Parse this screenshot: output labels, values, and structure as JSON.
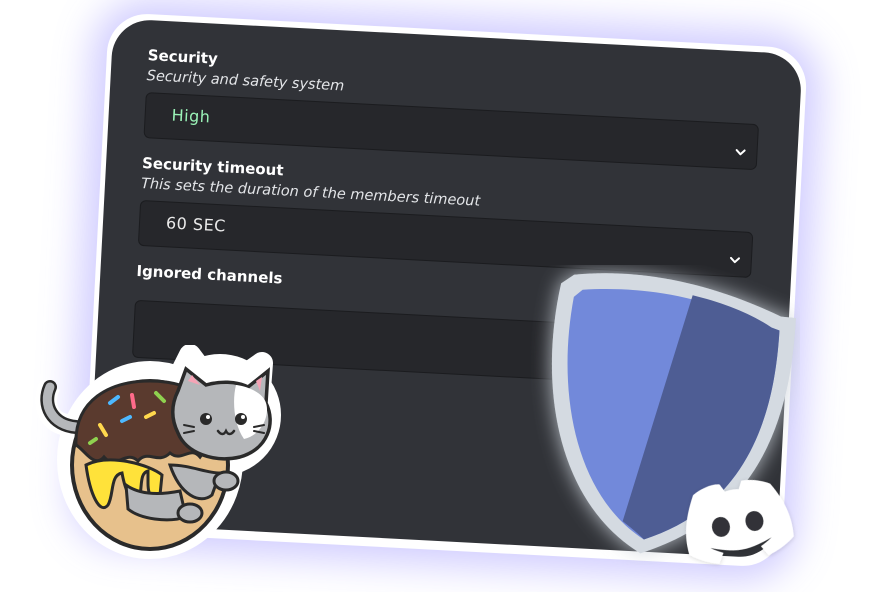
{
  "settings": {
    "security": {
      "title": "Security",
      "description": "Security and safety system",
      "value": "High"
    },
    "security_timeout": {
      "title": "Security timeout",
      "description": "This sets the duration of the members timeout",
      "value": "60 SEC"
    },
    "ignored_channels": {
      "title": "Ignored channels",
      "value": ""
    }
  },
  "icons": {
    "dropdown": "chevron-down-icon",
    "shield": "shield-icon",
    "cat": "donut-cat-sticker",
    "discord": "discord-logo-icon"
  },
  "colors": {
    "panel_bg": "#313338",
    "field_bg": "#26272b",
    "accent_green": "#9af2b7",
    "shield_light": "#7289da",
    "shield_dark": "#4e5d94",
    "glow": "#786eff"
  }
}
